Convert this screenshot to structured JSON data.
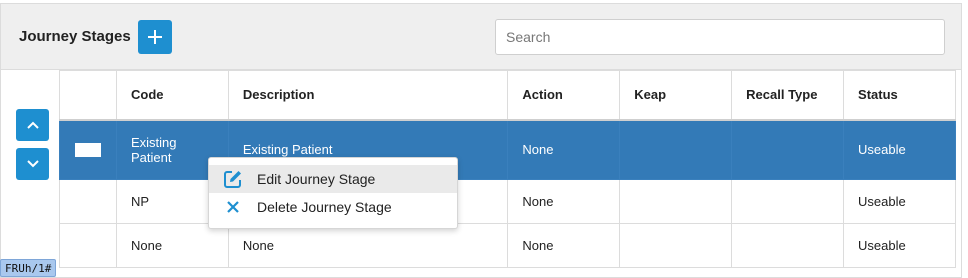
{
  "header": {
    "title": "Journey Stages",
    "add_icon": "plus-icon",
    "search_placeholder": "Search",
    "search_value": ""
  },
  "reorder": {
    "up_icon": "chevron-up-icon",
    "down_icon": "chevron-down-icon"
  },
  "table": {
    "columns": [
      "",
      "Code",
      "Description",
      "Action",
      "Keap",
      "Recall Type",
      "Status"
    ],
    "rows": [
      {
        "code_line1": "Existing",
        "code_line2": "Patient",
        "description": "Existing Patient",
        "action": "None",
        "keap": "",
        "recall_type": "",
        "status": "Useable",
        "selected": true
      },
      {
        "code": "NP",
        "description": "",
        "action": "None",
        "keap": "",
        "recall_type": "",
        "status": "Useable",
        "selected": false
      },
      {
        "code": "None",
        "description": "None",
        "action": "None",
        "keap": "",
        "recall_type": "",
        "status": "Useable",
        "selected": false
      }
    ]
  },
  "context_menu": {
    "items": [
      {
        "label": "Edit Journey Stage",
        "icon": "edit-icon"
      },
      {
        "label": "Delete Journey Stage",
        "icon": "close-icon"
      }
    ]
  },
  "debug_tag": "FRUh/1#",
  "colors": {
    "accent": "#1e8fd0",
    "selected_row": "#337ab7",
    "header_bg": "#efefef"
  }
}
